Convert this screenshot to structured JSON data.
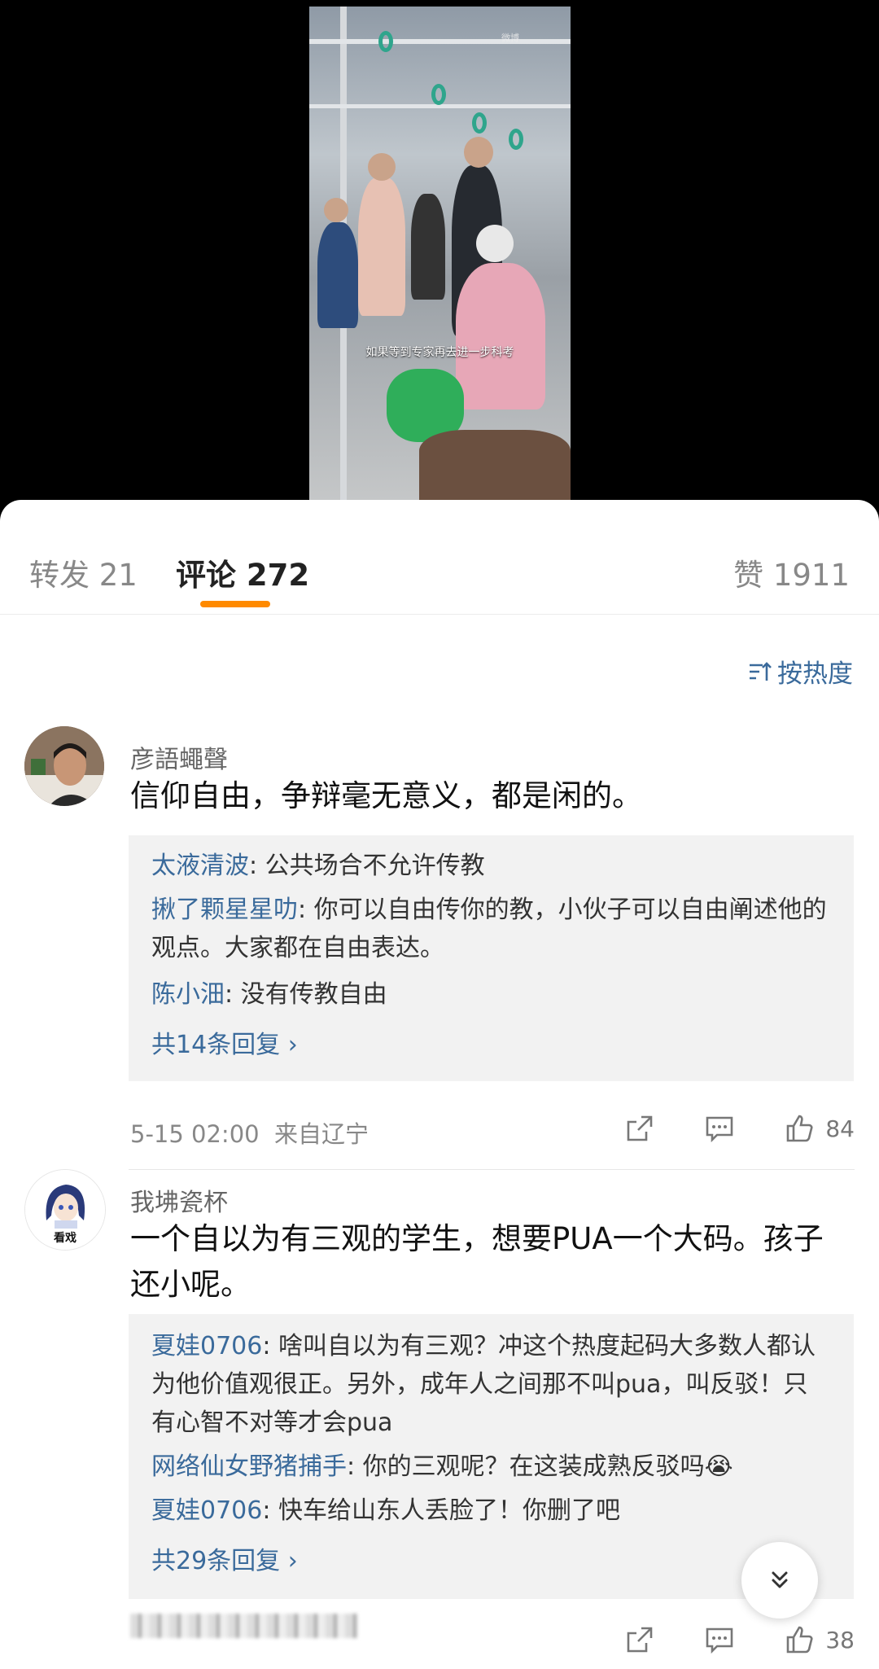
{
  "video": {
    "caption": "如果等到专家再去进一步科考",
    "watermark": "微博"
  },
  "tabs": {
    "repost": "转发 21",
    "comments": "评论 272",
    "likes": "赞 1911"
  },
  "sort": {
    "label": "按热度",
    "icon": "sort-icon"
  },
  "comments": [
    {
      "username": "彦語蠅聲",
      "text": "信仰自由，争辩毫无意义，都是闲的。",
      "replies": [
        {
          "name": "太液清波",
          "text": ": 公共场合不允许传教"
        },
        {
          "name": "揪了颗星星叻",
          "text": ": 你可以自由传你的教，小伙子可以自由阐述他的观点。大家都在自由表达。"
        },
        {
          "name": "陈小沺",
          "text": ": 没有传教自由"
        }
      ],
      "more": "共14条回复 ›",
      "time": "5-15 02:00",
      "location": "来自辽宁",
      "likes": "84"
    },
    {
      "username": "我坲瓷杯",
      "avatar_label": "看戏",
      "text": "一个自以为有三观的学生，想要PUA一个大码。孩子还小呢。",
      "replies": [
        {
          "name": "夏娃0706",
          "text": ": 啥叫自以为有三观？冲这个热度起码大多数人都认为他价值观很正。另外，成年人之间那不叫pua，叫反驳！只有心智不对等才会pua"
        },
        {
          "name": "网络仙女野猪捕手",
          "text": ": 你的三观呢？在这装成熟反驳吗😭"
        },
        {
          "name": "夏娃0706",
          "text": ": 快车给山东人丢脸了！你删了吧"
        }
      ],
      "more": "共29条回复 ›",
      "likes": "38"
    }
  ],
  "colors": {
    "accent": "#ff8a00",
    "link": "#3a6a9b"
  }
}
